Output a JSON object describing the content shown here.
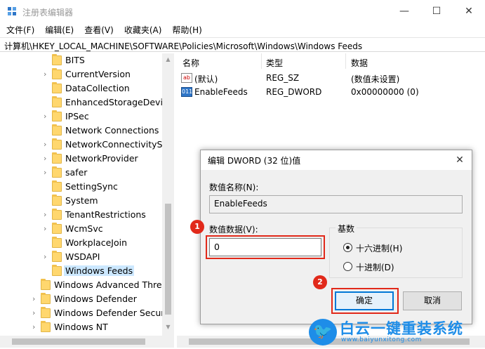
{
  "window": {
    "title": "注册表编辑器",
    "minimize": "—",
    "maximize": "☐",
    "close": "✕"
  },
  "menu": [
    "文件(F)",
    "编辑(E)",
    "查看(V)",
    "收藏夹(A)",
    "帮助(H)"
  ],
  "address": "计算机\\HKEY_LOCAL_MACHINE\\SOFTWARE\\Policies\\Microsoft\\Windows\\Windows Feeds",
  "tree": [
    {
      "label": "BITS",
      "level": 2,
      "expandable": false,
      "selected": false
    },
    {
      "label": "CurrentVersion",
      "level": 2,
      "expandable": true,
      "selected": false
    },
    {
      "label": "DataCollection",
      "level": 2,
      "expandable": false,
      "selected": false
    },
    {
      "label": "EnhancedStorageDevice",
      "level": 2,
      "expandable": false,
      "selected": false
    },
    {
      "label": "IPSec",
      "level": 2,
      "expandable": true,
      "selected": false
    },
    {
      "label": "Network Connections",
      "level": 2,
      "expandable": false,
      "selected": false
    },
    {
      "label": "NetworkConnectivitySta",
      "level": 2,
      "expandable": true,
      "selected": false
    },
    {
      "label": "NetworkProvider",
      "level": 2,
      "expandable": true,
      "selected": false
    },
    {
      "label": "safer",
      "level": 2,
      "expandable": true,
      "selected": false
    },
    {
      "label": "SettingSync",
      "level": 2,
      "expandable": false,
      "selected": false
    },
    {
      "label": "System",
      "level": 2,
      "expandable": false,
      "selected": false
    },
    {
      "label": "TenantRestrictions",
      "level": 2,
      "expandable": true,
      "selected": false
    },
    {
      "label": "WcmSvc",
      "level": 2,
      "expandable": true,
      "selected": false
    },
    {
      "label": "WorkplaceJoin",
      "level": 2,
      "expandable": false,
      "selected": false
    },
    {
      "label": "WSDAPI",
      "level": 2,
      "expandable": true,
      "selected": false
    },
    {
      "label": "Windows Feeds",
      "level": 2,
      "expandable": false,
      "selected": true
    },
    {
      "label": "Windows Advanced Threa",
      "level": 1,
      "expandable": false,
      "selected": false
    },
    {
      "label": "Windows Defender",
      "level": 1,
      "expandable": true,
      "selected": false
    },
    {
      "label": "Windows Defender Securit",
      "level": 1,
      "expandable": true,
      "selected": false
    },
    {
      "label": "Windows NT",
      "level": 1,
      "expandable": true,
      "selected": false
    }
  ],
  "list": {
    "headers": [
      "名称",
      "类型",
      "数据"
    ],
    "rows": [
      {
        "icon": "ab",
        "name": "(默认)",
        "type": "REG_SZ",
        "data": "(数值未设置)"
      },
      {
        "icon": "011",
        "name": "EnableFeeds",
        "type": "REG_DWORD",
        "data": "0x00000000 (0)"
      }
    ]
  },
  "dialog": {
    "title": "编辑 DWORD (32 位)值",
    "close": "✕",
    "name_label": "数值名称(N):",
    "name_value": "EnableFeeds",
    "data_label": "数值数据(V):",
    "data_value": "0",
    "base_label": "基数",
    "base_options": [
      {
        "label": "十六进制(H)",
        "checked": true
      },
      {
        "label": "十进制(D)",
        "checked": false
      }
    ],
    "ok": "确定",
    "cancel": "取消"
  },
  "annotations": {
    "step1": "1",
    "step2": "2"
  },
  "watermark": {
    "title": "白云一键重装系统",
    "url": "www.baiyunxitong.com"
  },
  "colors": {
    "accent": "#0078d7",
    "highlight": "#e1291a",
    "selection": "#cce8ff",
    "brand": "#1e8de8"
  }
}
